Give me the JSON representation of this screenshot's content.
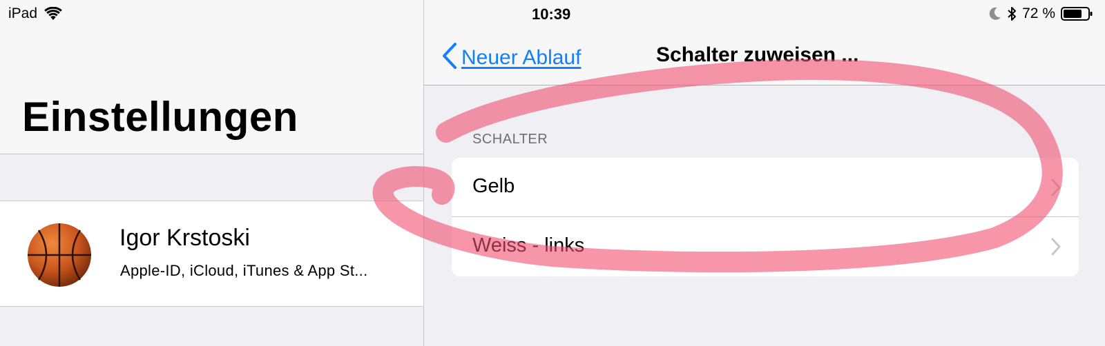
{
  "status_bar": {
    "device": "iPad",
    "time": "10:39",
    "battery": "72 %"
  },
  "sidebar": {
    "title": "Einstellungen",
    "profile": {
      "name": "Igor Krstoski",
      "subtitle": "Apple-ID, iCloud, iTunes & App St..."
    }
  },
  "detail": {
    "nav": {
      "back_label": "Neuer Ablauf",
      "title": "Schalter zuweisen ..."
    },
    "section_header": "SCHALTER",
    "items": [
      {
        "label": "Gelb"
      },
      {
        "label": "Weiss - links"
      }
    ]
  },
  "colors": {
    "accent": "#147efb",
    "annotation": "#f0506e",
    "background": "#efeff4"
  },
  "icons": [
    "wifi-icon",
    "moon-icon",
    "bluetooth-icon",
    "battery-icon",
    "back-chevron-icon",
    "chevron-right-icon",
    "basketball-avatar"
  ]
}
